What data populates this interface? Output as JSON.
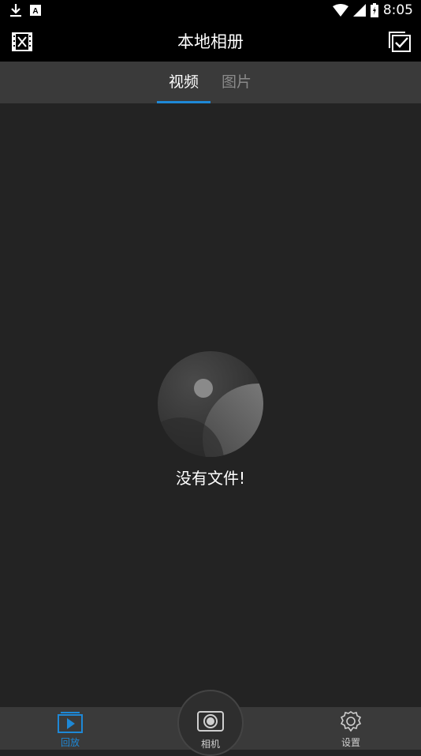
{
  "status_bar": {
    "time": "8:05",
    "icons": [
      "download-icon",
      "text-a-icon",
      "wifi-icon",
      "signal-icon",
      "battery-icon"
    ]
  },
  "app_bar": {
    "title": "本地相册",
    "left_icon": "film-icon",
    "right_icon": "select-checkbox-icon"
  },
  "tabs": [
    {
      "label": "视频",
      "active": true
    },
    {
      "label": "图片",
      "active": false
    }
  ],
  "empty_state": {
    "message": "没有文件!"
  },
  "bottom_nav": {
    "items": [
      {
        "label": "回放",
        "icon": "play-icon",
        "active": true
      },
      {
        "label": "相机",
        "icon": "camera-icon",
        "active": false
      },
      {
        "label": "设置",
        "icon": "gear-icon",
        "active": false
      }
    ]
  },
  "colors": {
    "accent": "#1e88d6",
    "background": "#232323",
    "bar": "#3a3a3a"
  }
}
